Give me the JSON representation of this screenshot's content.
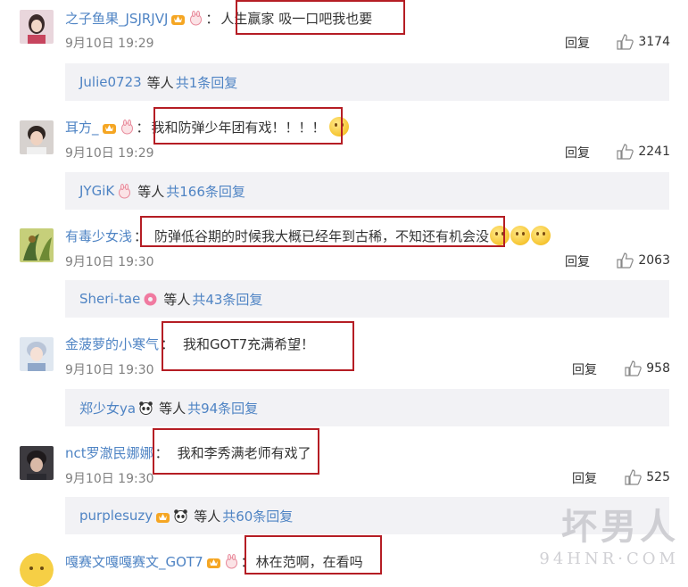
{
  "comments": [
    {
      "username": "之子鱼果_JSJRJVJ",
      "text": "人生赢家 吸一口吧我也要",
      "time": "9月10日 19:29",
      "reply_label": "回复",
      "likes": "3174",
      "badges": [
        "crown-badge-icon",
        "rabbit-badge-icon"
      ],
      "emojis": [],
      "reply_summary": {
        "name": "Julie0723",
        "mid": "等人",
        "count": "共1条回复",
        "badge": ""
      }
    },
    {
      "username": "耳方_",
      "text": "我和防弹少年团有戏！！！！",
      "time": "9月10日 19:29",
      "reply_label": "回复",
      "likes": "2241",
      "badges": [
        "crown-badge-icon",
        "rabbit-badge-icon"
      ],
      "emojis": [
        "smirk-emoji-icon"
      ],
      "reply_summary": {
        "name": "JYGiK",
        "mid": "等人",
        "count": "共166条回复",
        "badge": "rabbit-badge-icon"
      }
    },
    {
      "username": "有毒少女浅",
      "text": "防弹低谷期的时候我大概已经年到古稀，不知还有机会没",
      "time": "9月10日 19:30",
      "reply_label": "回复",
      "likes": "2063",
      "badges": [],
      "emojis": [
        "smile-emoji-icon",
        "smile-emoji-icon",
        "smile-emoji-icon"
      ],
      "reply_summary": {
        "name": "Sheri-tae",
        "mid": "等人",
        "count": "共43条回复",
        "badge": "donut-badge-icon"
      }
    },
    {
      "username": "金菠萝的小寒气",
      "text": "我和GOT7充满希望！",
      "time": "9月10日 19:30",
      "reply_label": "回复",
      "likes": "958",
      "badges": [],
      "emojis": [],
      "reply_summary": {
        "name": "郑少女ya",
        "mid": "等人",
        "count": "共94条回复",
        "badge": "panda-badge-icon"
      }
    },
    {
      "username": "nct罗澈民娜娜",
      "text": "我和李秀满老师有戏了",
      "time": "9月10日 19:30",
      "reply_label": "回复",
      "likes": "525",
      "badges": [],
      "emojis": [],
      "reply_summary": {
        "name": "purplesuzy",
        "mid": "等人",
        "count": "共60条回复",
        "badge": "crown-panda-badge-icon"
      }
    },
    {
      "username": "嘎赛文嘎嘎赛文_GOT7",
      "text": "林在范啊，在看吗",
      "time": "",
      "reply_label": "",
      "likes": "",
      "badges": [
        "crown-badge-icon",
        "rabbit-badge-icon"
      ],
      "emojis": [],
      "reply_summary": null
    }
  ],
  "watermark": {
    "line1": "坏男人",
    "line2": "94HNR·COM"
  },
  "colors": {
    "link": "#4f84c4",
    "highlight_box": "#b51d24",
    "reply_bg": "#f2f2f5",
    "time": "#808080"
  }
}
